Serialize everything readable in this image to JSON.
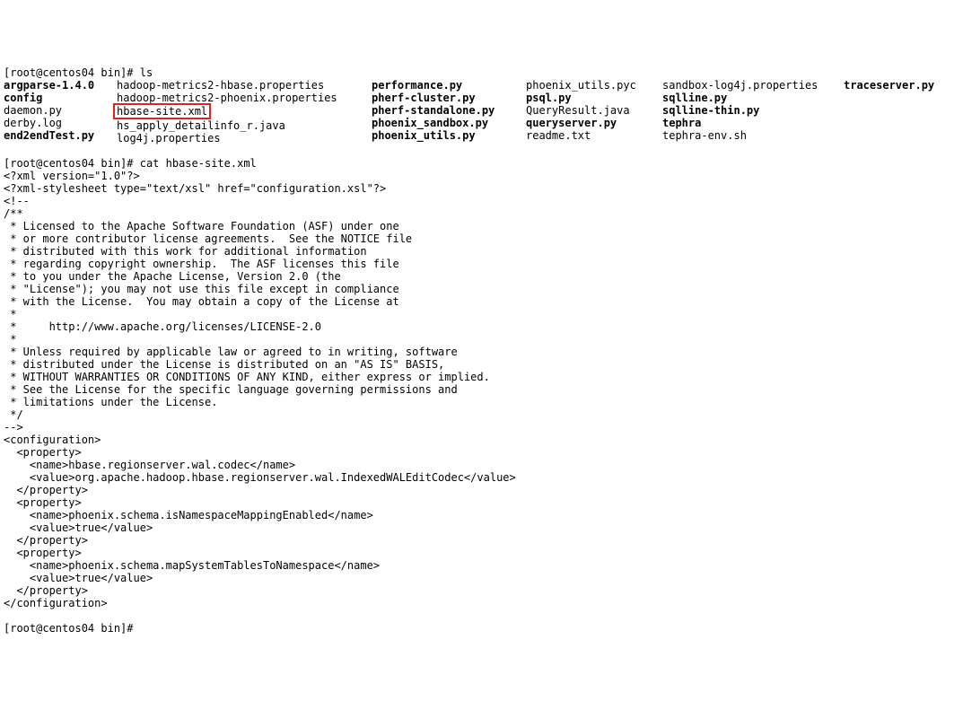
{
  "prompt1": "[root@centos04 bin]# ",
  "cmd_ls": "ls",
  "ls": {
    "c0": [
      "argparse-1.4.0",
      "config",
      "daemon.py",
      "derby.log",
      "end2endTest.py"
    ],
    "c0_bold": [
      true,
      true,
      false,
      false,
      true
    ],
    "c1": [
      "hadoop-metrics2-hbase.properties",
      "hadoop-metrics2-phoenix.properties",
      "hbase-site.xml",
      "hs_apply_detailinfo_r.java",
      "log4j.properties"
    ],
    "c1_hl": [
      false,
      false,
      true,
      false,
      false
    ],
    "c2": [
      "performance.py",
      "pherf-cluster.py",
      "pherf-standalone.py",
      "phoenix_sandbox.py",
      "phoenix_utils.py"
    ],
    "c2_bold": [
      true,
      true,
      true,
      true,
      true
    ],
    "c3": [
      "phoenix_utils.pyc",
      "psql.py",
      "QueryResult.java",
      "queryserver.py",
      "readme.txt"
    ],
    "c3_bold": [
      false,
      true,
      false,
      true,
      false
    ],
    "c4": [
      "sandbox-log4j.properties",
      "sqlline.py",
      "sqlline-thin.py",
      "tephra",
      "tephra-env.sh"
    ],
    "c4_bold": [
      false,
      true,
      true,
      true,
      false
    ],
    "c5": [
      "traceserver.py"
    ],
    "c5_bold": [
      true
    ]
  },
  "cmd_cat": "cat hbase-site.xml",
  "xml_lines": [
    "<?xml version=\"1.0\"?>",
    "<?xml-stylesheet type=\"text/xsl\" href=\"configuration.xsl\"?>",
    "<!--",
    "/**",
    " * Licensed to the Apache Software Foundation (ASF) under one",
    " * or more contributor license agreements.  See the NOTICE file",
    " * distributed with this work for additional information",
    " * regarding copyright ownership.  The ASF licenses this file",
    " * to you under the Apache License, Version 2.0 (the",
    " * \"License\"); you may not use this file except in compliance",
    " * with the License.  You may obtain a copy of the License at",
    " *",
    " *     http://www.apache.org/licenses/LICENSE-2.0",
    " *",
    " * Unless required by applicable law or agreed to in writing, software",
    " * distributed under the License is distributed on an \"AS IS\" BASIS,",
    " * WITHOUT WARRANTIES OR CONDITIONS OF ANY KIND, either express or implied.",
    " * See the License for the specific language governing permissions and",
    " * limitations under the License.",
    " */",
    "-->",
    "<configuration>",
    "  <property>",
    "    <name>hbase.regionserver.wal.codec</name>",
    "    <value>org.apache.hadoop.hbase.regionserver.wal.IndexedWALEditCodec</value>",
    "  </property>",
    "  <property>",
    "    <name>phoenix.schema.isNamespaceMappingEnabled</name>",
    "    <value>true</value>",
    "  </property>",
    "  <property>",
    "    <name>phoenix.schema.mapSystemTablesToNamespace</name>",
    "    <value>true</value>",
    "  </property>",
    "</configuration>"
  ],
  "prompt_end": "[root@centos04 bin]# "
}
